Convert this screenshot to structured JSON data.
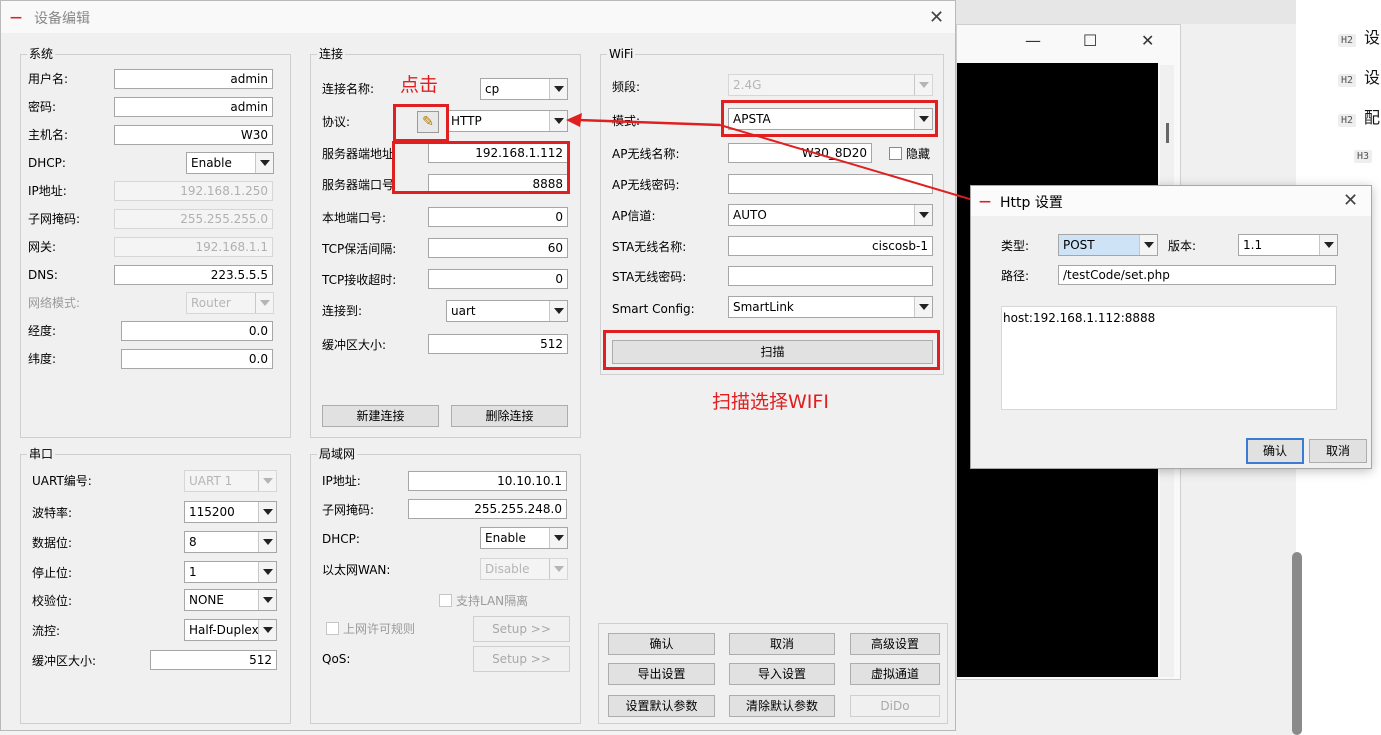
{
  "main_dialog": {
    "title": "设备编辑",
    "system": {
      "title": "系统",
      "username_label": "用户名:",
      "username": "admin",
      "password_label": "密码:",
      "password": "admin",
      "hostname_label": "主机名:",
      "hostname": "W30",
      "dhcp_label": "DHCP:",
      "dhcp": "Enable",
      "ip_label": "IP地址:",
      "ip": "192.168.1.250",
      "mask_label": "子网掩码:",
      "mask": "255.255.255.0",
      "gateway_label": "网关:",
      "gateway": "192.168.1.1",
      "dns_label": "DNS:",
      "dns": "223.5.5.5",
      "netmode_label": "网络模式:",
      "netmode": "Router",
      "longitude_label": "经度:",
      "longitude": "0.0",
      "latitude_label": "纬度:",
      "latitude": "0.0"
    },
    "connect": {
      "title": "连接",
      "name_label": "连接名称:",
      "name": "cp",
      "protocol_label": "协议:",
      "protocol": "HTTP",
      "server_addr_label": "服务器端地址",
      "server_addr": "192.168.1.112",
      "server_port_label": "服务器端口号",
      "server_port": "8888",
      "local_port_label": "本地端口号:",
      "local_port": "0",
      "keepalive_label": "TCP保活间隔:",
      "keepalive": "60",
      "timeout_label": "TCP接收超时:",
      "timeout": "0",
      "connect_to_label": "连接到:",
      "connect_to": "uart",
      "buffer_label": "缓冲区大小:",
      "buffer": "512",
      "new_btn": "新建连接",
      "delete_btn": "删除连接"
    },
    "wifi": {
      "title": "WiFi",
      "band_label": "频段:",
      "band": "2.4G",
      "mode_label": "模式:",
      "mode": "APSTA",
      "ap_ssid_label": "AP无线名称:",
      "ap_ssid": "W30_8D20",
      "hide_label": "隐藏",
      "ap_pwd_label": "AP无线密码:",
      "ap_pwd": "",
      "ap_channel_label": "AP信道:",
      "ap_channel": "AUTO",
      "sta_ssid_label": "STA无线名称:",
      "sta_ssid": "ciscosb-1",
      "sta_pwd_label": "STA无线密码:",
      "sta_pwd": "",
      "smart_label": "Smart Config:",
      "smart": "SmartLink",
      "scan_btn": "扫描"
    },
    "serial": {
      "title": "串口",
      "uart_label": "UART编号:",
      "uart": "UART 1",
      "baud_label": "波特率:",
      "baud": "115200",
      "databits_label": "数据位:",
      "databits": "8",
      "stopbits_label": "停止位:",
      "stopbits": "1",
      "parity_label": "校验位:",
      "parity": "NONE",
      "flow_label": "流控:",
      "flow": "Half-Duplex",
      "buffer_label": "缓冲区大小:",
      "buffer": "512"
    },
    "lan": {
      "title": "局域网",
      "ip_label": "IP地址:",
      "ip": "10.10.10.1",
      "mask_label": "子网掩码:",
      "mask": "255.255.248.0",
      "dhcp_label": "DHCP:",
      "dhcp": "Enable",
      "wan_label": "以太网WAN:",
      "wan": "Disable",
      "lan_isolation_label": "支持LAN隔离",
      "access_rule_label": "上网许可规则",
      "setup_btn": "Setup >>",
      "qos_label": "QoS:",
      "qos_setup_btn": "Setup >>"
    },
    "actions": {
      "confirm": "确认",
      "cancel": "取消",
      "advanced": "高级设置",
      "export": "导出设置",
      "import": "导入设置",
      "virtual": "虚拟通道",
      "set_default": "设置默认参数",
      "clear_default": "清除默认参数",
      "dido": "DiDo"
    }
  },
  "annotations": {
    "click": "点击",
    "scan_hint": "扫描选择WIFI"
  },
  "http_dialog": {
    "title": "Http 设置",
    "type_label": "类型:",
    "type": "POST",
    "version_label": "版本:",
    "version": "1.1",
    "path_label": "路径:",
    "path": "/testCode/set.php",
    "headers": "host:192.168.1.112:8888",
    "confirm": "确认",
    "cancel": "取消"
  },
  "background": {
    "toc": [
      {
        "tag": "H2",
        "text": "设"
      },
      {
        "tag": "H2",
        "text": "设"
      },
      {
        "tag": "H2",
        "text": "配"
      },
      {
        "tag": "H3",
        "text": ""
      }
    ]
  },
  "colors": {
    "annotation_red": "#e02020",
    "combo_selected": "#cfe3f7",
    "default_button_border": "#3b7bd4"
  }
}
